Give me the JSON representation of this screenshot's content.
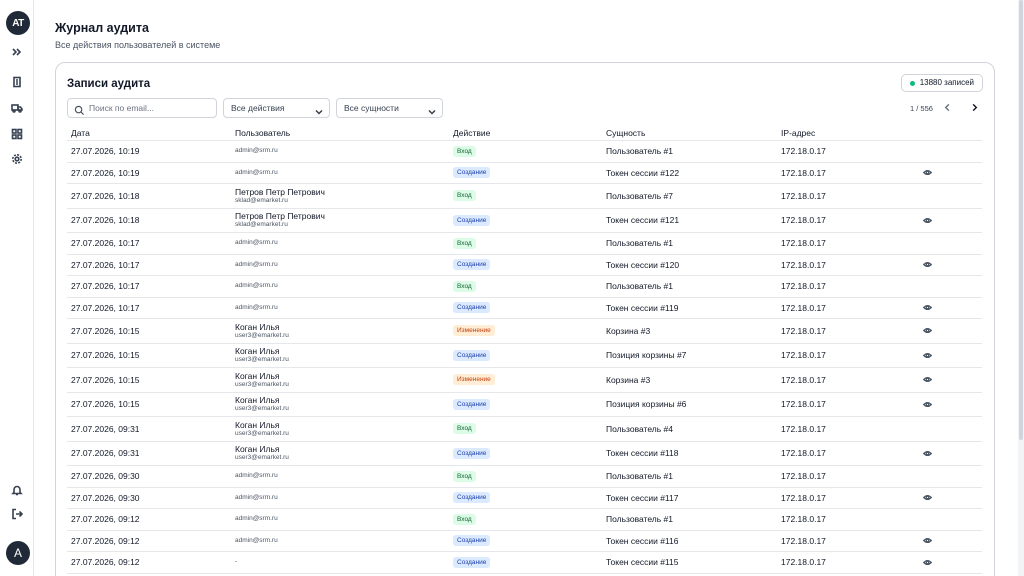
{
  "sidebar": {
    "logo_text": "AT",
    "avatar_letter": "A"
  },
  "header": {
    "title": "Журнал аудита",
    "subtitle": "Все действия пользователей в системе"
  },
  "card": {
    "title": "Записи аудита",
    "count_label": "13880 записей",
    "search_placeholder": "Поиск по email...",
    "filter_action": "Все действия",
    "filter_entity": "Все сущности",
    "pager": "1 / 556"
  },
  "columns": {
    "date": "Дата",
    "user": "Пользователь",
    "action": "Действие",
    "entity": "Сущность",
    "ip": "IP-адрес"
  },
  "colors": {
    "accent": "#1f2937",
    "status_dot": "#10b981"
  },
  "rows": [
    {
      "date": "27.07.2026, 10:19",
      "name": "",
      "email": "admin@srm.ru",
      "action": "Вход",
      "kind": "login",
      "entity": "Пользователь #1",
      "ip": "172.18.0.17",
      "eye": false
    },
    {
      "date": "27.07.2026, 10:19",
      "name": "",
      "email": "admin@srm.ru",
      "action": "Создание",
      "kind": "create",
      "entity": "Токен сессии #122",
      "ip": "172.18.0.17",
      "eye": true
    },
    {
      "date": "27.07.2026, 10:18",
      "name": "Петров Петр Петрович",
      "email": "sklad@emarket.ru",
      "action": "Вход",
      "kind": "login",
      "entity": "Пользователь #7",
      "ip": "172.18.0.17",
      "eye": false
    },
    {
      "date": "27.07.2026, 10:18",
      "name": "Петров Петр Петрович",
      "email": "sklad@emarket.ru",
      "action": "Создание",
      "kind": "create",
      "entity": "Токен сессии #121",
      "ip": "172.18.0.17",
      "eye": true
    },
    {
      "date": "27.07.2026, 10:17",
      "name": "",
      "email": "admin@srm.ru",
      "action": "Вход",
      "kind": "login",
      "entity": "Пользователь #1",
      "ip": "172.18.0.17",
      "eye": false
    },
    {
      "date": "27.07.2026, 10:17",
      "name": "",
      "email": "admin@srm.ru",
      "action": "Создание",
      "kind": "create",
      "entity": "Токен сессии #120",
      "ip": "172.18.0.17",
      "eye": true
    },
    {
      "date": "27.07.2026, 10:17",
      "name": "",
      "email": "admin@srm.ru",
      "action": "Вход",
      "kind": "login",
      "entity": "Пользователь #1",
      "ip": "172.18.0.17",
      "eye": false
    },
    {
      "date": "27.07.2026, 10:17",
      "name": "",
      "email": "admin@srm.ru",
      "action": "Создание",
      "kind": "create",
      "entity": "Токен сессии #119",
      "ip": "172.18.0.17",
      "eye": true
    },
    {
      "date": "27.07.2026, 10:15",
      "name": "Коган Илья",
      "email": "user3@emarket.ru",
      "action": "Изменение",
      "kind": "change",
      "entity": "Корзина #3",
      "ip": "172.18.0.17",
      "eye": true
    },
    {
      "date": "27.07.2026, 10:15",
      "name": "Коган Илья",
      "email": "user3@emarket.ru",
      "action": "Создание",
      "kind": "create",
      "entity": "Позиция корзины #7",
      "ip": "172.18.0.17",
      "eye": true
    },
    {
      "date": "27.07.2026, 10:15",
      "name": "Коган Илья",
      "email": "user3@emarket.ru",
      "action": "Изменение",
      "kind": "change",
      "entity": "Корзина #3",
      "ip": "172.18.0.17",
      "eye": true
    },
    {
      "date": "27.07.2026, 10:15",
      "name": "Коган Илья",
      "email": "user3@emarket.ru",
      "action": "Создание",
      "kind": "create",
      "entity": "Позиция корзины #6",
      "ip": "172.18.0.17",
      "eye": true
    },
    {
      "date": "27.07.2026, 09:31",
      "name": "Коган Илья",
      "email": "user3@emarket.ru",
      "action": "Вход",
      "kind": "login",
      "entity": "Пользователь #4",
      "ip": "172.18.0.17",
      "eye": false
    },
    {
      "date": "27.07.2026, 09:31",
      "name": "Коган Илья",
      "email": "user3@emarket.ru",
      "action": "Создание",
      "kind": "create",
      "entity": "Токен сессии #118",
      "ip": "172.18.0.17",
      "eye": true
    },
    {
      "date": "27.07.2026, 09:30",
      "name": "",
      "email": "admin@srm.ru",
      "action": "Вход",
      "kind": "login",
      "entity": "Пользователь #1",
      "ip": "172.18.0.17",
      "eye": false
    },
    {
      "date": "27.07.2026, 09:30",
      "name": "",
      "email": "admin@srm.ru",
      "action": "Создание",
      "kind": "create",
      "entity": "Токен сессии #117",
      "ip": "172.18.0.17",
      "eye": true
    },
    {
      "date": "27.07.2026, 09:12",
      "name": "",
      "email": "admin@srm.ru",
      "action": "Вход",
      "kind": "login",
      "entity": "Пользователь #1",
      "ip": "172.18.0.17",
      "eye": false
    },
    {
      "date": "27.07.2026, 09:12",
      "name": "",
      "email": "admin@srm.ru",
      "action": "Создание",
      "kind": "create",
      "entity": "Токен сессии #116",
      "ip": "172.18.0.17",
      "eye": true
    },
    {
      "date": "27.07.2026, 09:12",
      "name": "",
      "email": "-",
      "action": "Создание",
      "kind": "create",
      "entity": "Токен сессии #115",
      "ip": "172.18.0.17",
      "eye": true
    }
  ]
}
